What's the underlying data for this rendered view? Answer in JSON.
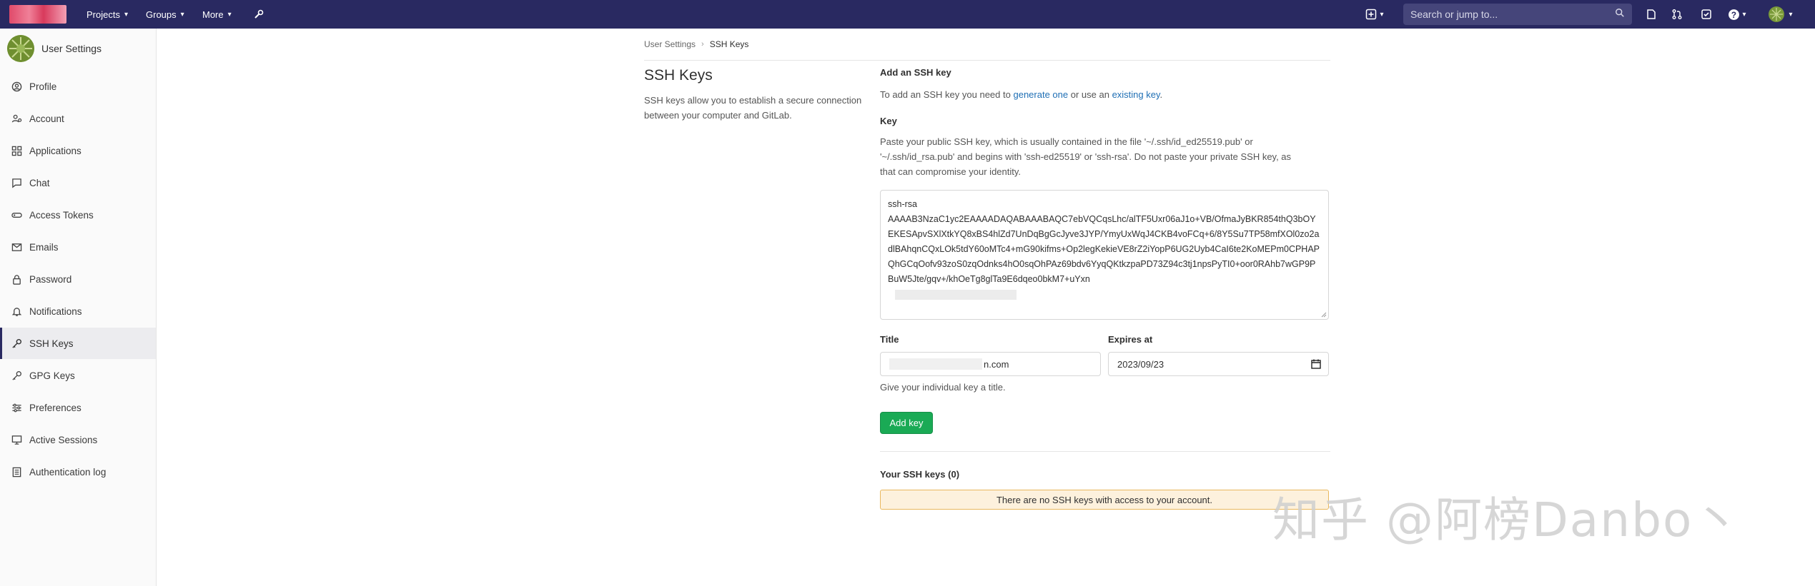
{
  "navbar": {
    "projects": "Projects",
    "groups": "Groups",
    "more": "More",
    "search_placeholder": "Search or jump to..."
  },
  "sidebar": {
    "title": "User Settings",
    "items": [
      {
        "label": "Profile",
        "icon": "profile-icon"
      },
      {
        "label": "Account",
        "icon": "account-icon"
      },
      {
        "label": "Applications",
        "icon": "applications-icon"
      },
      {
        "label": "Chat",
        "icon": "chat-icon"
      },
      {
        "label": "Access Tokens",
        "icon": "token-icon"
      },
      {
        "label": "Emails",
        "icon": "email-icon"
      },
      {
        "label": "Password",
        "icon": "lock-icon"
      },
      {
        "label": "Notifications",
        "icon": "bell-icon"
      },
      {
        "label": "SSH Keys",
        "icon": "key-icon",
        "active": true
      },
      {
        "label": "GPG Keys",
        "icon": "key-icon"
      },
      {
        "label": "Preferences",
        "icon": "preferences-icon"
      },
      {
        "label": "Active Sessions",
        "icon": "monitor-icon"
      },
      {
        "label": "Authentication log",
        "icon": "log-icon"
      }
    ]
  },
  "breadcrumb": {
    "parent": "User Settings",
    "current": "SSH Keys"
  },
  "page": {
    "title": "SSH Keys",
    "description": "SSH keys allow you to establish a secure connection between your computer and GitLab."
  },
  "add_key": {
    "heading": "Add an SSH key",
    "intro_prefix": "To add an SSH key you need to",
    "generate_link": "generate one",
    "intro_mid": "or use an",
    "existing_link": "existing key",
    "intro_suffix": ".",
    "key_label": "Key",
    "key_help_1": "Paste your public SSH key, which is usually contained in the file '~/.ssh/id_ed25519.pub' or",
    "key_help_2": "'~/.ssh/id_rsa.pub' and begins with 'ssh-ed25519' or 'ssh-rsa'. Do not paste your private SSH key, as",
    "key_help_3": "that can compromise your identity.",
    "key_value_line1": "ssh-rsa",
    "key_value_body": "AAAAB3NzaC1yc2EAAAADAQABAAABAQC7ebVQCqsLhc/alTF5Uxr06aJ1o+VB/OfmaJyBKR854thQ3bOYEKESApvSXlXtkYQ8xBS4hlZd7UnDqBgGcJyve3JYP/YmyUxWqJ4CKB4voFCq+6/8Y5Su7TP58mfXOl0zo2adlBAhqnCQxLOk5tdY60oMTc4+mG90kifms+Op2legKekieVE8rZ2iYopP6UG2Uyb4CaI6te2KoMEPm0CPHAPQhGCqOofv93zoS0zqOdnks4hO0sqOhPAz69bdv6YyqQKtkzpaPD73Z94c3tj1npsPyTI0+oor0RAhb7wGP9PBuW5Jte/gqv+/khOeTg8glTa9E6dqeo0bkM7+uYxn",
    "title_label": "Title",
    "title_value_visible": "n.com",
    "title_help": "Give your individual key a title.",
    "expires_label": "Expires at",
    "expires_value": "2023/09/23",
    "add_button": "Add key"
  },
  "your_keys": {
    "heading": "Your SSH keys (0)",
    "empty_message": "There are no SSH keys with access to your account."
  },
  "watermark": "知乎 @阿榜Danbo丶",
  "colors": {
    "navbar": "#292961",
    "accent_link": "#1f6fb5",
    "add_button": "#1aaa55",
    "warning_bg": "#fdf1dd",
    "warning_border": "#e9b85e"
  }
}
